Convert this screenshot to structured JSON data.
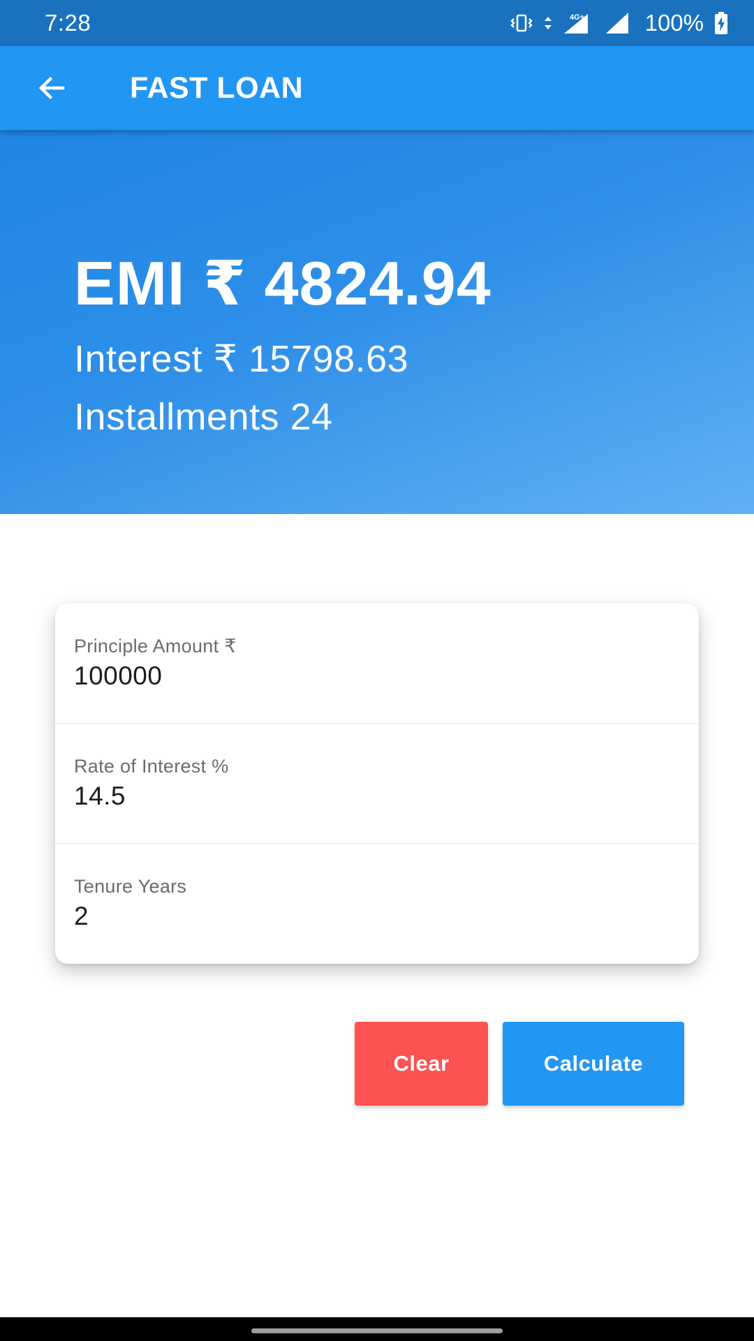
{
  "status_bar": {
    "time": "7:28",
    "network": "4G+",
    "battery": "100%"
  },
  "app_bar": {
    "title": "FAST LOAN"
  },
  "result": {
    "emi": "EMI ₹ 4824.94",
    "interest": "Interest ₹ 15798.63",
    "installments": "Installments 24"
  },
  "form": {
    "principal": {
      "label": "Principle Amount ₹",
      "value": "100000"
    },
    "rate": {
      "label": "Rate of Interest %",
      "value": "14.5"
    },
    "tenure": {
      "label": "Tenure Years",
      "value": "2"
    }
  },
  "buttons": {
    "clear": "Clear",
    "calculate": "Calculate"
  },
  "colors": {
    "primary": "#2196f3",
    "status_bar": "#1a72bf",
    "clear_button": "#fc5252"
  }
}
